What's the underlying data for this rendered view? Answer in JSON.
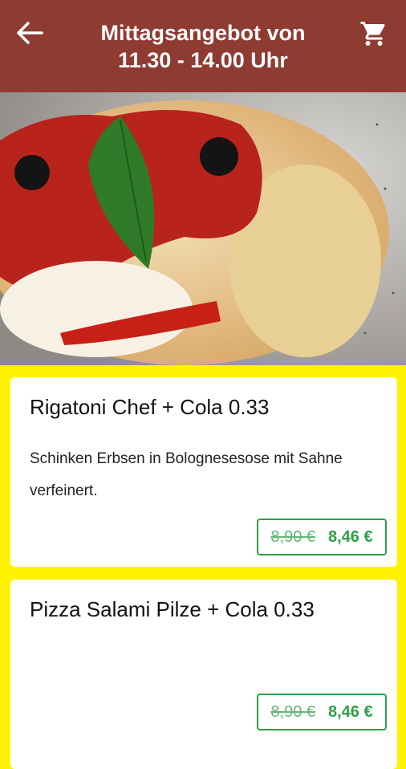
{
  "header": {
    "title": "Mittagsangebot von\n11.30 - 14.00 Uhr",
    "back_icon": "arrow-left-icon",
    "cart_icon": "shopping-cart-icon"
  },
  "hero": {
    "description": "pizza"
  },
  "colors": {
    "header": "#8E3B32",
    "background": "#FFF200",
    "price": "#2F9E4A"
  },
  "products": [
    {
      "name": "Rigatoni Chef + Cola 0.33",
      "description": "Schinken Erbsen in Bolognesesose mit Sahne verfeinert.",
      "old_price": "8,90 €",
      "new_price": "8,46 €"
    },
    {
      "name": "Pizza Salami Pilze + Cola 0.33",
      "description": "",
      "old_price": "8,90 €",
      "new_price": "8,46 €"
    }
  ]
}
